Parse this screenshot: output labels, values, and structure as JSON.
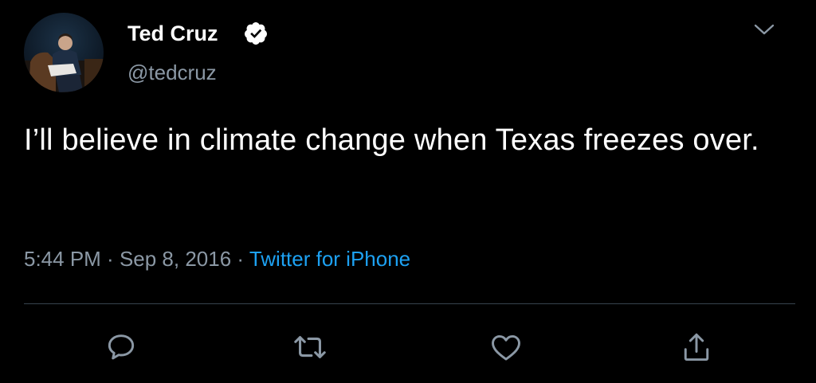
{
  "author": {
    "display_name": "Ted Cruz",
    "handle": "@tedcruz",
    "verified": true,
    "avatar_icon": "profile-photo"
  },
  "tweet": {
    "text": "I’ll believe in climate change when Texas freezes over."
  },
  "meta": {
    "time": "5:44 PM",
    "separator": " · ",
    "date": "Sep 8, 2016",
    "source": "Twitter for iPhone"
  },
  "actions": [
    {
      "name": "reply",
      "icon": "speech-bubble-icon"
    },
    {
      "name": "retweet",
      "icon": "retweet-arrows-icon"
    },
    {
      "name": "like",
      "icon": "heart-icon"
    },
    {
      "name": "share",
      "icon": "share-upload-icon"
    }
  ],
  "colors": {
    "background": "#000000",
    "text_primary": "#ffffff",
    "text_secondary": "#8b98a5",
    "accent": "#1da1f2",
    "divider": "#38444d"
  }
}
